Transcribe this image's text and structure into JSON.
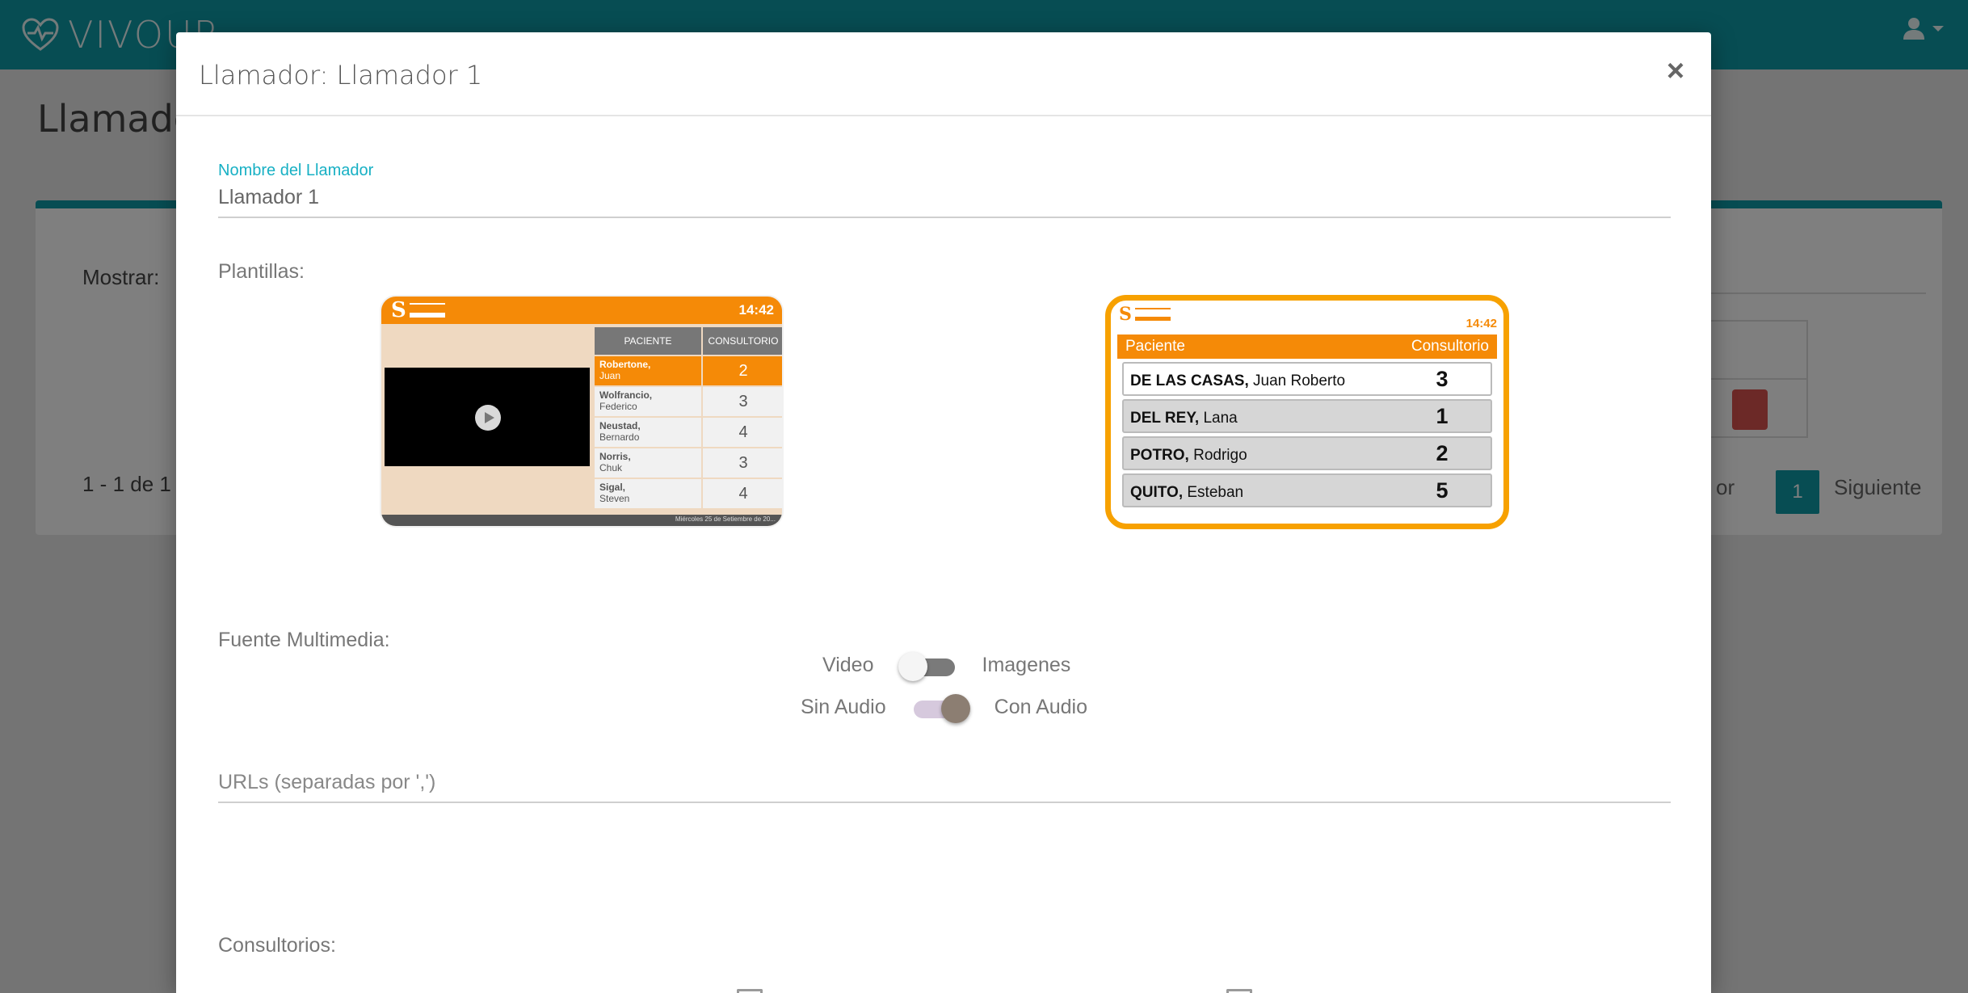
{
  "app": {
    "brand": "VIVOUR",
    "page_title": "Llamador",
    "show_label": "Mostrar:",
    "count_text": "1 - 1 de 1",
    "pagination": {
      "prev": "or",
      "current": "1",
      "next": "Siguiente"
    }
  },
  "modal": {
    "title": "Llamador: Llamador 1",
    "close": "×",
    "name_field": {
      "label": "Nombre del Llamador",
      "value": "Llamador 1"
    },
    "templates_label": "Plantillas:",
    "template1": {
      "time": "14:42",
      "col_patient": "PACIENTE",
      "col_office": "CONSULTORIO",
      "rows": [
        {
          "last": "Robertone,",
          "first": "Juan",
          "office": "2"
        },
        {
          "last": "Wolfrancio,",
          "first": "Federico",
          "office": "3"
        },
        {
          "last": "Neustad,",
          "first": "Bernardo",
          "office": "4"
        },
        {
          "last": "Norris,",
          "first": "Chuk",
          "office": "3"
        },
        {
          "last": "Sigal,",
          "first": "Steven",
          "office": "4"
        }
      ],
      "footer": "Miércoles 25 de Setiembre de 20..."
    },
    "template2": {
      "time": "14:42",
      "col_patient": "Paciente",
      "col_office": "Consultorio",
      "rows": [
        {
          "last": "DE LAS CASAS,",
          "first": " Juan Roberto",
          "office": "3"
        },
        {
          "last": "DEL REY,",
          "first": " Lana",
          "office": "1"
        },
        {
          "last": "POTRO,",
          "first": " Rodrigo",
          "office": "2"
        },
        {
          "last": "QUITO,",
          "first": " Esteban",
          "office": "5"
        }
      ],
      "selected": true
    },
    "media_label": "Fuente Multimedia:",
    "media_toggle": {
      "left": "Video",
      "right": "Imagenes",
      "state": "Video"
    },
    "audio_toggle": {
      "left": "Sin Audio",
      "right": "Con Audio",
      "state": "Con Audio"
    },
    "urls_placeholder": "URLs (separadas por ',')",
    "offices_label": "Consultorios:"
  },
  "colors": {
    "primary": "#0e9aa7",
    "accent_orange": "#f58a07",
    "selected_border": "#f7a100",
    "label_cyan": "#17b0c4"
  }
}
